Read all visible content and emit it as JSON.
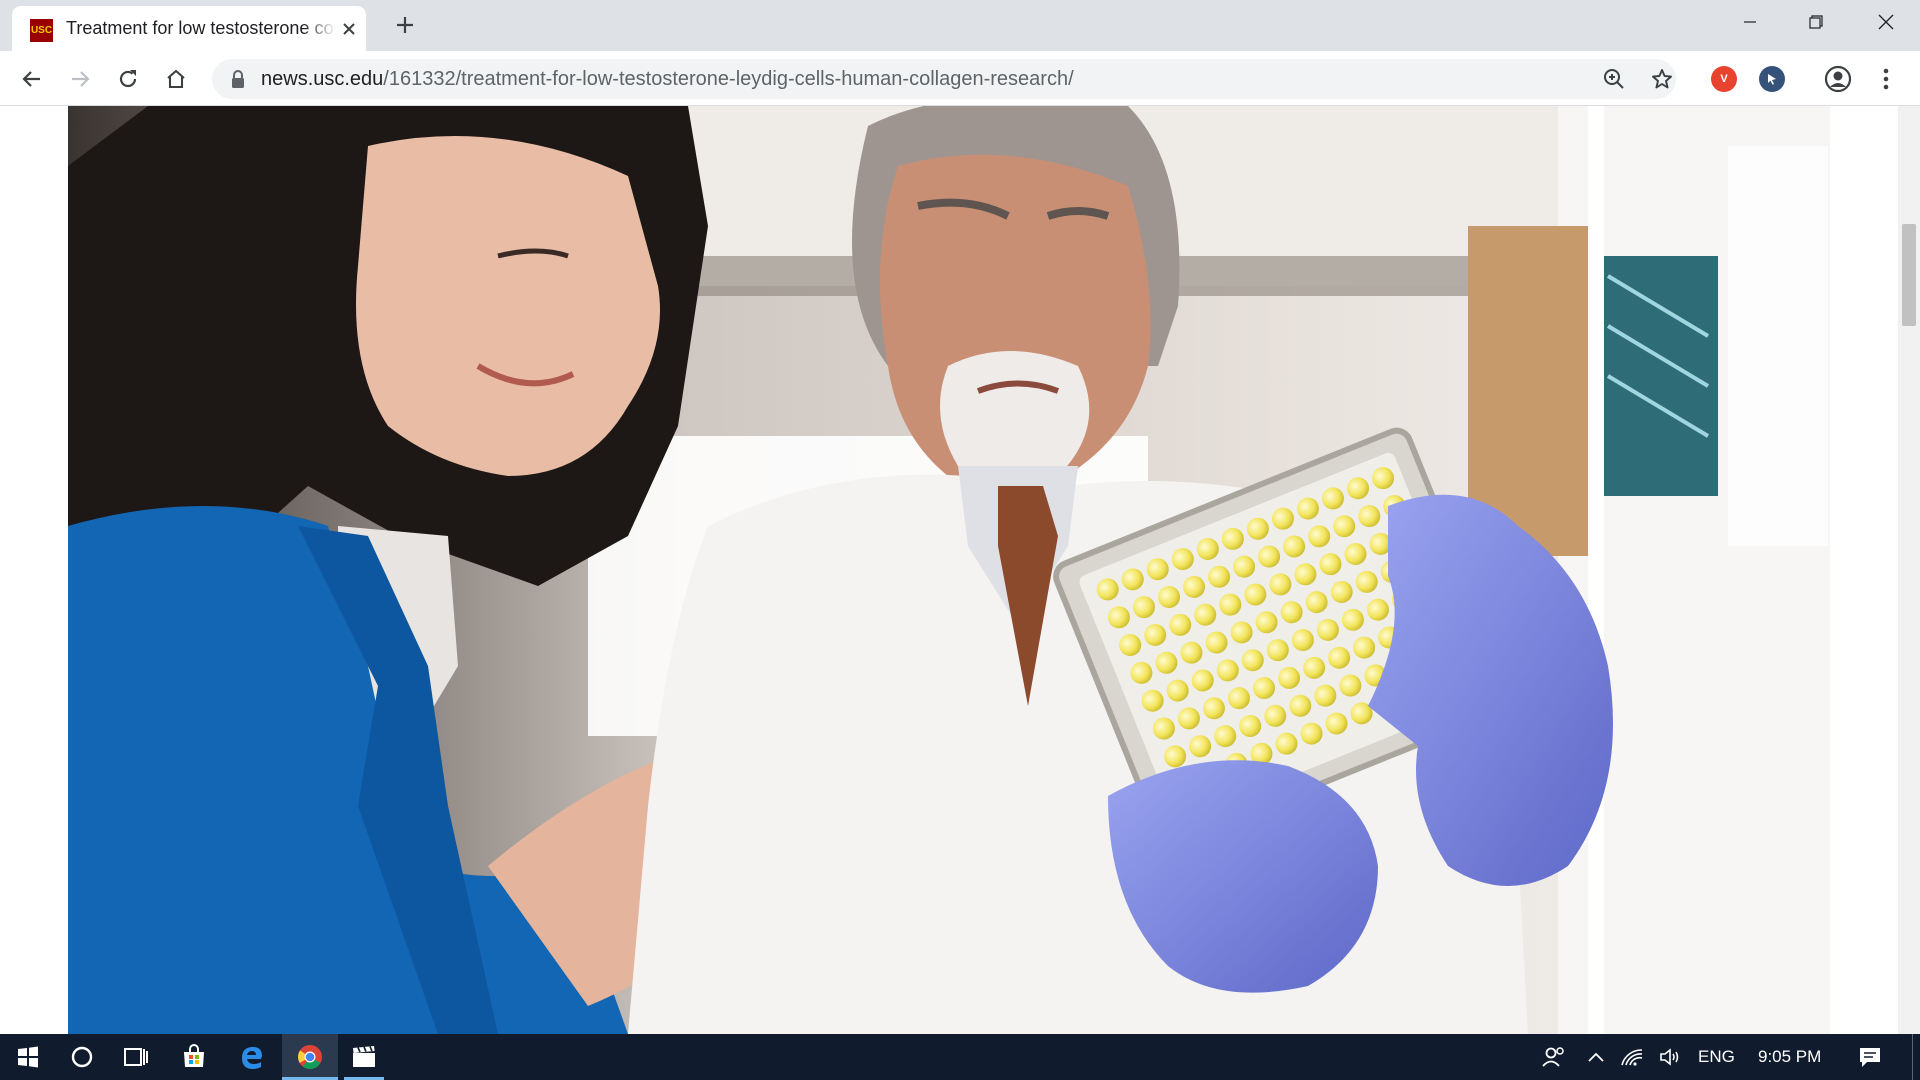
{
  "browser": {
    "tab": {
      "favicon_text": "USC",
      "title": "Treatment for low testosterone could be on the horizon"
    },
    "address": {
      "host": "news.usc.edu",
      "path": "/161332/treatment-for-low-testosterone-leydig-cells-human-collagen-research/"
    },
    "extensions": [
      {
        "name": "avast-online-security",
        "label": "V",
        "color": "#e8432e"
      },
      {
        "name": "pointer-extension",
        "label": "",
        "color": "#35527a"
      }
    ]
  },
  "page": {
    "hero_image": "Two researchers in a lab examining a 96-well plate with yellow samples, wearing blue nitrile gloves"
  },
  "taskbar": {
    "language": "ENG",
    "time": "9:05 PM"
  },
  "colors": {
    "tabstrip_bg": "#dee1e6",
    "taskbar_bg": "#101c2e",
    "usc_cardinal": "#990000",
    "glove_blue": "#7b86e0"
  }
}
